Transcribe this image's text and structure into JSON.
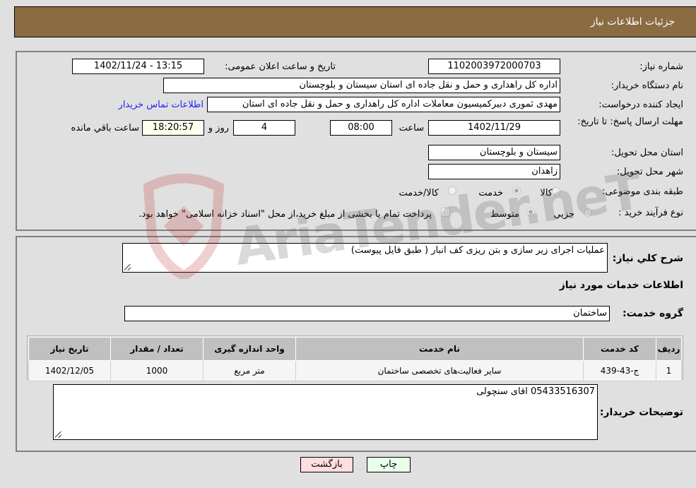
{
  "header": {
    "title": "جزئیات اطلاعات نیاز"
  },
  "form": {
    "need_number": {
      "label": "شماره نیاز:",
      "value": "1102003972000703"
    },
    "announce_datetime": {
      "label": "تاریخ و ساعت اعلان عمومی:",
      "value": "1402/11/24 - 13:15"
    },
    "buyer_org": {
      "label": "نام دستگاه خریدار:",
      "value": "اداره کل راهداری و حمل و نقل جاده ای استان سیستان و بلوچستان"
    },
    "creator": {
      "label": "ایجاد کننده درخواست:",
      "value": "مهدی ثموری دبیرکمیسیون معاملات اداره کل راهداری و حمل و نقل جاده ای استان",
      "contact_link": "اطلاعات تماس خریدار"
    },
    "deadline": {
      "label": "مهلت ارسال پاسخ: تا تاریخ:",
      "date": "1402/11/29",
      "time_label": "ساعت",
      "time": "08:00",
      "days": "4",
      "days_label": "روز و",
      "remaining": "18:20:57",
      "remaining_label": "ساعت باقي مانده"
    },
    "province": {
      "label": "استان محل تحویل:",
      "value": "سیستان و بلوچستان"
    },
    "city": {
      "label": "شهر محل تحویل:",
      "value": "زاهدان"
    },
    "category": {
      "label": "طبقه بندی موضوعی:",
      "options": [
        "کالا",
        "خدمت",
        "کالا/خدمت"
      ],
      "selected": "خدمت"
    },
    "purchase_type": {
      "label": "نوع فرآیند خرید :",
      "options": [
        "جزیي",
        "متوسط"
      ],
      "selected": "متوسط",
      "treasury_note": "پرداخت تمام یا بخشی از مبلغ خرید،از محل \"اسناد خزانه اسلامی\" خواهد بود."
    }
  },
  "details": {
    "description_label": "شرح کلي نیاز:",
    "description": "عملیات اجرای زیر سازی و بتن ریزی کف انبار ( طبق فایل پیوست)",
    "services_heading": "اطلاعات خدمات مورد نیاز",
    "service_group_label": "گروه خدمت:",
    "service_group": "ساختمان",
    "table": {
      "headers": [
        "ردیف",
        "کد خدمت",
        "نام خدمت",
        "واحد اندازه گیری",
        "تعداد / مقدار",
        "تاریخ نیاز"
      ],
      "rows": [
        [
          "1",
          "ج-43-439",
          "سایر فعالیت‌های تخصصی ساختمان",
          "متر مربع",
          "1000",
          "1402/12/05"
        ]
      ]
    },
    "buyer_notes_label": "توضیحات خریدار:",
    "buyer_notes": "05433516307 اقای سنچولی"
  },
  "buttons": {
    "print": "چاپ",
    "back": "بازگشت"
  },
  "watermark": {
    "text": "AriaTender.neT"
  },
  "colors": {
    "header_bg": "#8b6b42",
    "print_bg": "#eaffea",
    "back_bg": "#ffdede",
    "link": "#2020ff"
  }
}
